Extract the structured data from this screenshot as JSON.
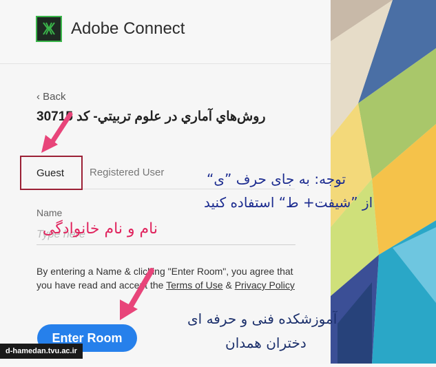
{
  "app": {
    "brand": "Adobe Connect"
  },
  "nav": {
    "back_label": "‹ Back"
  },
  "room": {
    "title": "روش‌هاي آماري در علوم تربيتي- کد 30715"
  },
  "tabs": [
    {
      "label": "Guest",
      "active": true
    },
    {
      "label": "Registered User",
      "active": false
    }
  ],
  "form": {
    "name_label": "Name",
    "name_placeholder": "Type here",
    "agree_prefix": "By entering a Name & clicking \"Enter Room\", you agree that you have read and accept the ",
    "terms_label": "Terms of Use",
    "agree_mid": " & ",
    "privacy_label": "Privacy Policy",
    "enter_label": "Enter Room"
  },
  "annotations": {
    "note_line1": "توجه: به جای حرف ”ی“",
    "note_line2": "از ”شیفت+ ط“ استفاده کنید",
    "name_hint": "نام و نام خانوادگی",
    "school_line1": "آموزشکده فنی و حرفه ای",
    "school_line2": "دختران همدان"
  },
  "watermark": {
    "text": "d-hamedan.tvu.ac.ir"
  },
  "colors": {
    "accent": "#2680eb",
    "annotation_arrow": "#e8457a",
    "guest_border": "#9b2035"
  }
}
